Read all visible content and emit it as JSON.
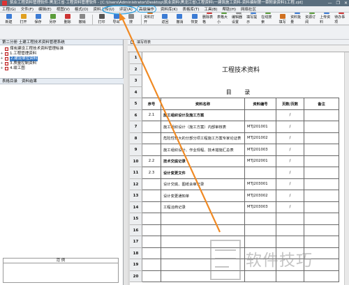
{
  "window": {
    "title": "筑业工程资料管理软件·黑龙江省·工程资料管理软件 - [C:\\Users\\Administrator\\Desktop\\筑业资料\\黑龙江省\\工程资料\\一建筑施工资料-资料编制第一章附录资料1工程.zjd]",
    "controls": [
      "—",
      "❐",
      "✕"
    ]
  },
  "menu": [
    "工程(G)",
    "文件(F)",
    "编辑(E)",
    "视图(V)",
    "格式(O)",
    "资料上传(U)",
    "评定(A)",
    "高级操作",
    "资料库(K)",
    "表格库(T)",
    "工具(B)",
    "帮助(H)",
    "网络社区"
  ],
  "menu_highlight_index": 7,
  "toolbar": [
    "新建",
    "打开",
    "保存",
    "另存",
    "删除",
    "撤销",
    "打印",
    "导出",
    "搜",
    "资料打开",
    "返回",
    "撤消",
    "恢复",
    "删除表格",
    "表格大小",
    "编辑器设置",
    "填写提示",
    "在线搜索",
    "填写",
    "资料批量",
    "资源订阅",
    "上传资料",
    "待办事项"
  ],
  "left_panel": {
    "header": "第二分册 土建工程技术资料管理系统",
    "tree": [
      {
        "label": "煤炭建设工程技术资料管理标准",
        "expand": "",
        "selected": false
      },
      {
        "label": "1.工程管理资料",
        "expand": "+",
        "selected": false
      },
      {
        "label": "2.建设单位资料",
        "expand": "+",
        "selected": true
      },
      {
        "label": "3.质量控制资料",
        "expand": "+",
        "selected": false
      },
      {
        "label": "4.竣工图",
        "expand": "+",
        "selected": false
      }
    ],
    "tabs": [
      "表格目录",
      "资料结果"
    ],
    "legend_header": "范    例"
  },
  "doc": {
    "sheet_tab": "填写样表",
    "title": "工程技术资料",
    "subtitle": "目    录",
    "headers": [
      "序号",
      "资料名称",
      "资料编号",
      "页数/页数",
      "备注"
    ],
    "rows": [
      {
        "no": "2.1",
        "name": "施工组织设计及施工方案",
        "code": "",
        "pages": "/",
        "bold": true
      },
      {
        "no": "",
        "name": "施工组织设计（施工方案）内部审核表",
        "code": "MTJ201001",
        "pages": "/",
        "bold": false
      },
      {
        "no": "",
        "name": "危险性较大的分部分项工程施工方案专家论证表",
        "code": "MTJ201002",
        "pages": "/",
        "bold": false
      },
      {
        "no": "",
        "name": "施工组织设计、作业规程、技术措施汇总表",
        "code": "MTJ201003",
        "pages": "/",
        "bold": false
      },
      {
        "no": "2.2",
        "name": "技术交底记录",
        "code": "MTJ202001",
        "pages": "/",
        "bold": true
      },
      {
        "no": "2.3",
        "name": "设计变更文件",
        "code": "",
        "pages": "/",
        "bold": true
      },
      {
        "no": "",
        "name": "设计交底、图纸会审记录",
        "code": "MTJ203001",
        "pages": "/",
        "bold": false
      },
      {
        "no": "",
        "name": "设计变更通知单",
        "code": "MTJ203002",
        "pages": "/",
        "bold": false
      },
      {
        "no": "",
        "name": "工程洽商记录",
        "code": "MTJ203003",
        "pages": "/",
        "bold": false
      }
    ],
    "row_numbers": [
      "1",
      "2",
      "3",
      "4",
      "5",
      "6",
      "7",
      "8",
      "9",
      "10",
      "11",
      "12",
      "13",
      "14",
      "15",
      "16",
      "17",
      "18",
      "19",
      "20"
    ]
  },
  "watermark": "软件技巧",
  "colors": {
    "titlebar": "#5a6e7e",
    "highlight": "#2aa0e0",
    "arrow": "#f08a24",
    "selected": "#3478c6"
  }
}
